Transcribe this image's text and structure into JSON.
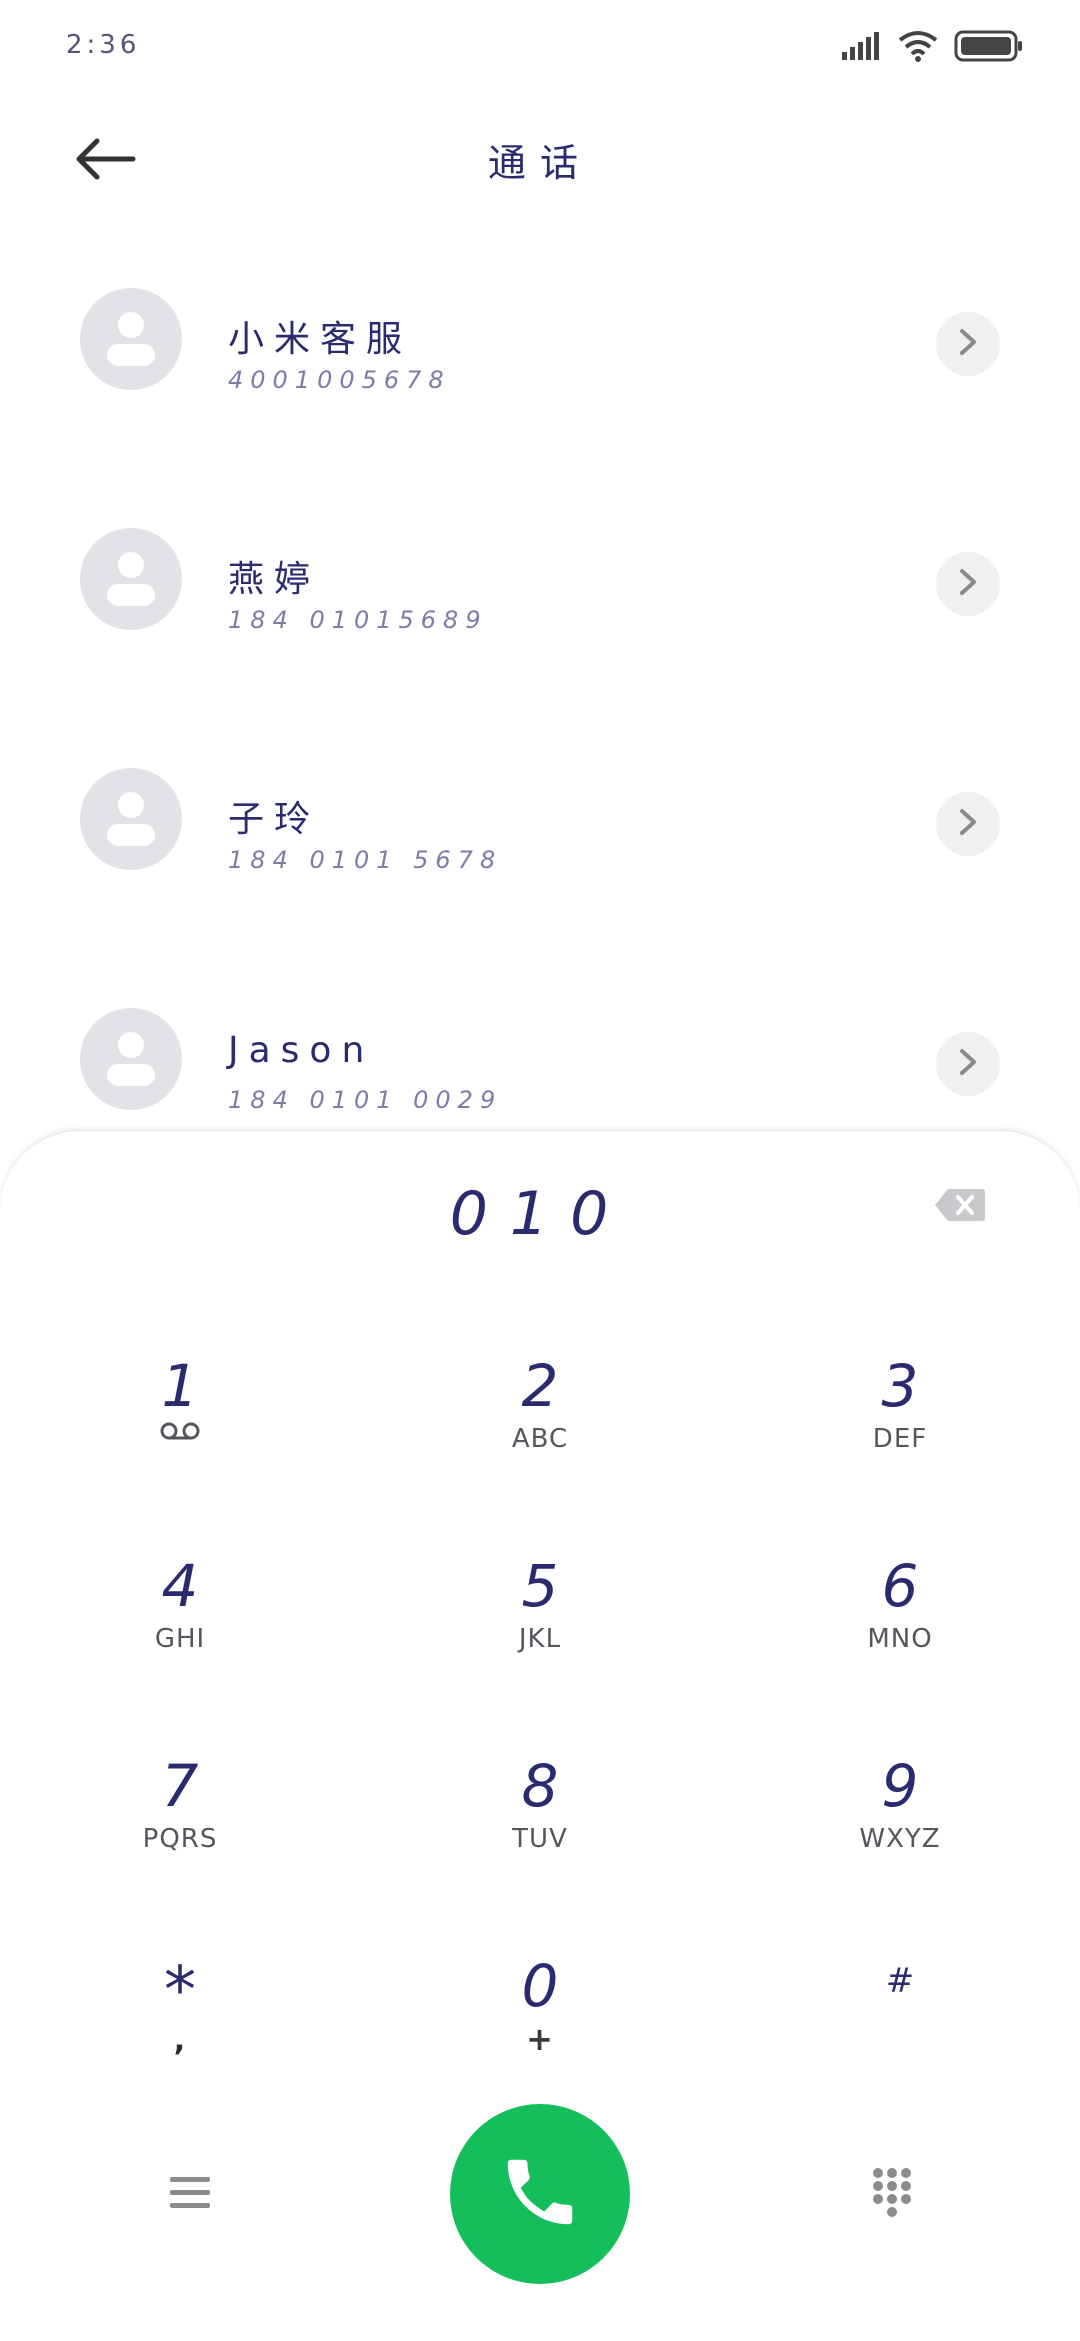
{
  "status_bar": {
    "time": "2:36",
    "icons": [
      "signal-icon",
      "wifi-icon",
      "battery-icon"
    ]
  },
  "header": {
    "title": "通话",
    "back_icon": "arrow-left-icon"
  },
  "contacts": [
    {
      "name": "小米客服",
      "number": "4001005678"
    },
    {
      "name": "燕婷",
      "number": "184 01015689"
    },
    {
      "name": "子玲",
      "number": "184 0101 5678"
    },
    {
      "name": "Jason",
      "number": "184 0101 0029"
    }
  ],
  "dialer": {
    "input": "010",
    "backspace_icon": "backspace-icon",
    "keys": [
      {
        "digit": "1",
        "letters": "",
        "sub_icon": "voicemail-icon"
      },
      {
        "digit": "2",
        "letters": "ABC"
      },
      {
        "digit": "3",
        "letters": "DEF"
      },
      {
        "digit": "4",
        "letters": "GHI"
      },
      {
        "digit": "5",
        "letters": "JKL"
      },
      {
        "digit": "6",
        "letters": "MNO"
      },
      {
        "digit": "7",
        "letters": "PQRS"
      },
      {
        "digit": "8",
        "letters": "TUV"
      },
      {
        "digit": "9",
        "letters": "WXYZ"
      },
      {
        "digit": "*",
        "letters": ","
      },
      {
        "digit": "0",
        "letters": "+"
      },
      {
        "digit": "#",
        "letters": ""
      }
    ]
  },
  "bottom_bar": {
    "menu_icon": "menu-icon",
    "call_icon": "phone-icon",
    "dialpad_icon": "dialpad-icon"
  },
  "colors": {
    "accent_text": "#2a2a6e",
    "call_green": "#13be5b",
    "avatar_bg": "#e1e3e7"
  }
}
